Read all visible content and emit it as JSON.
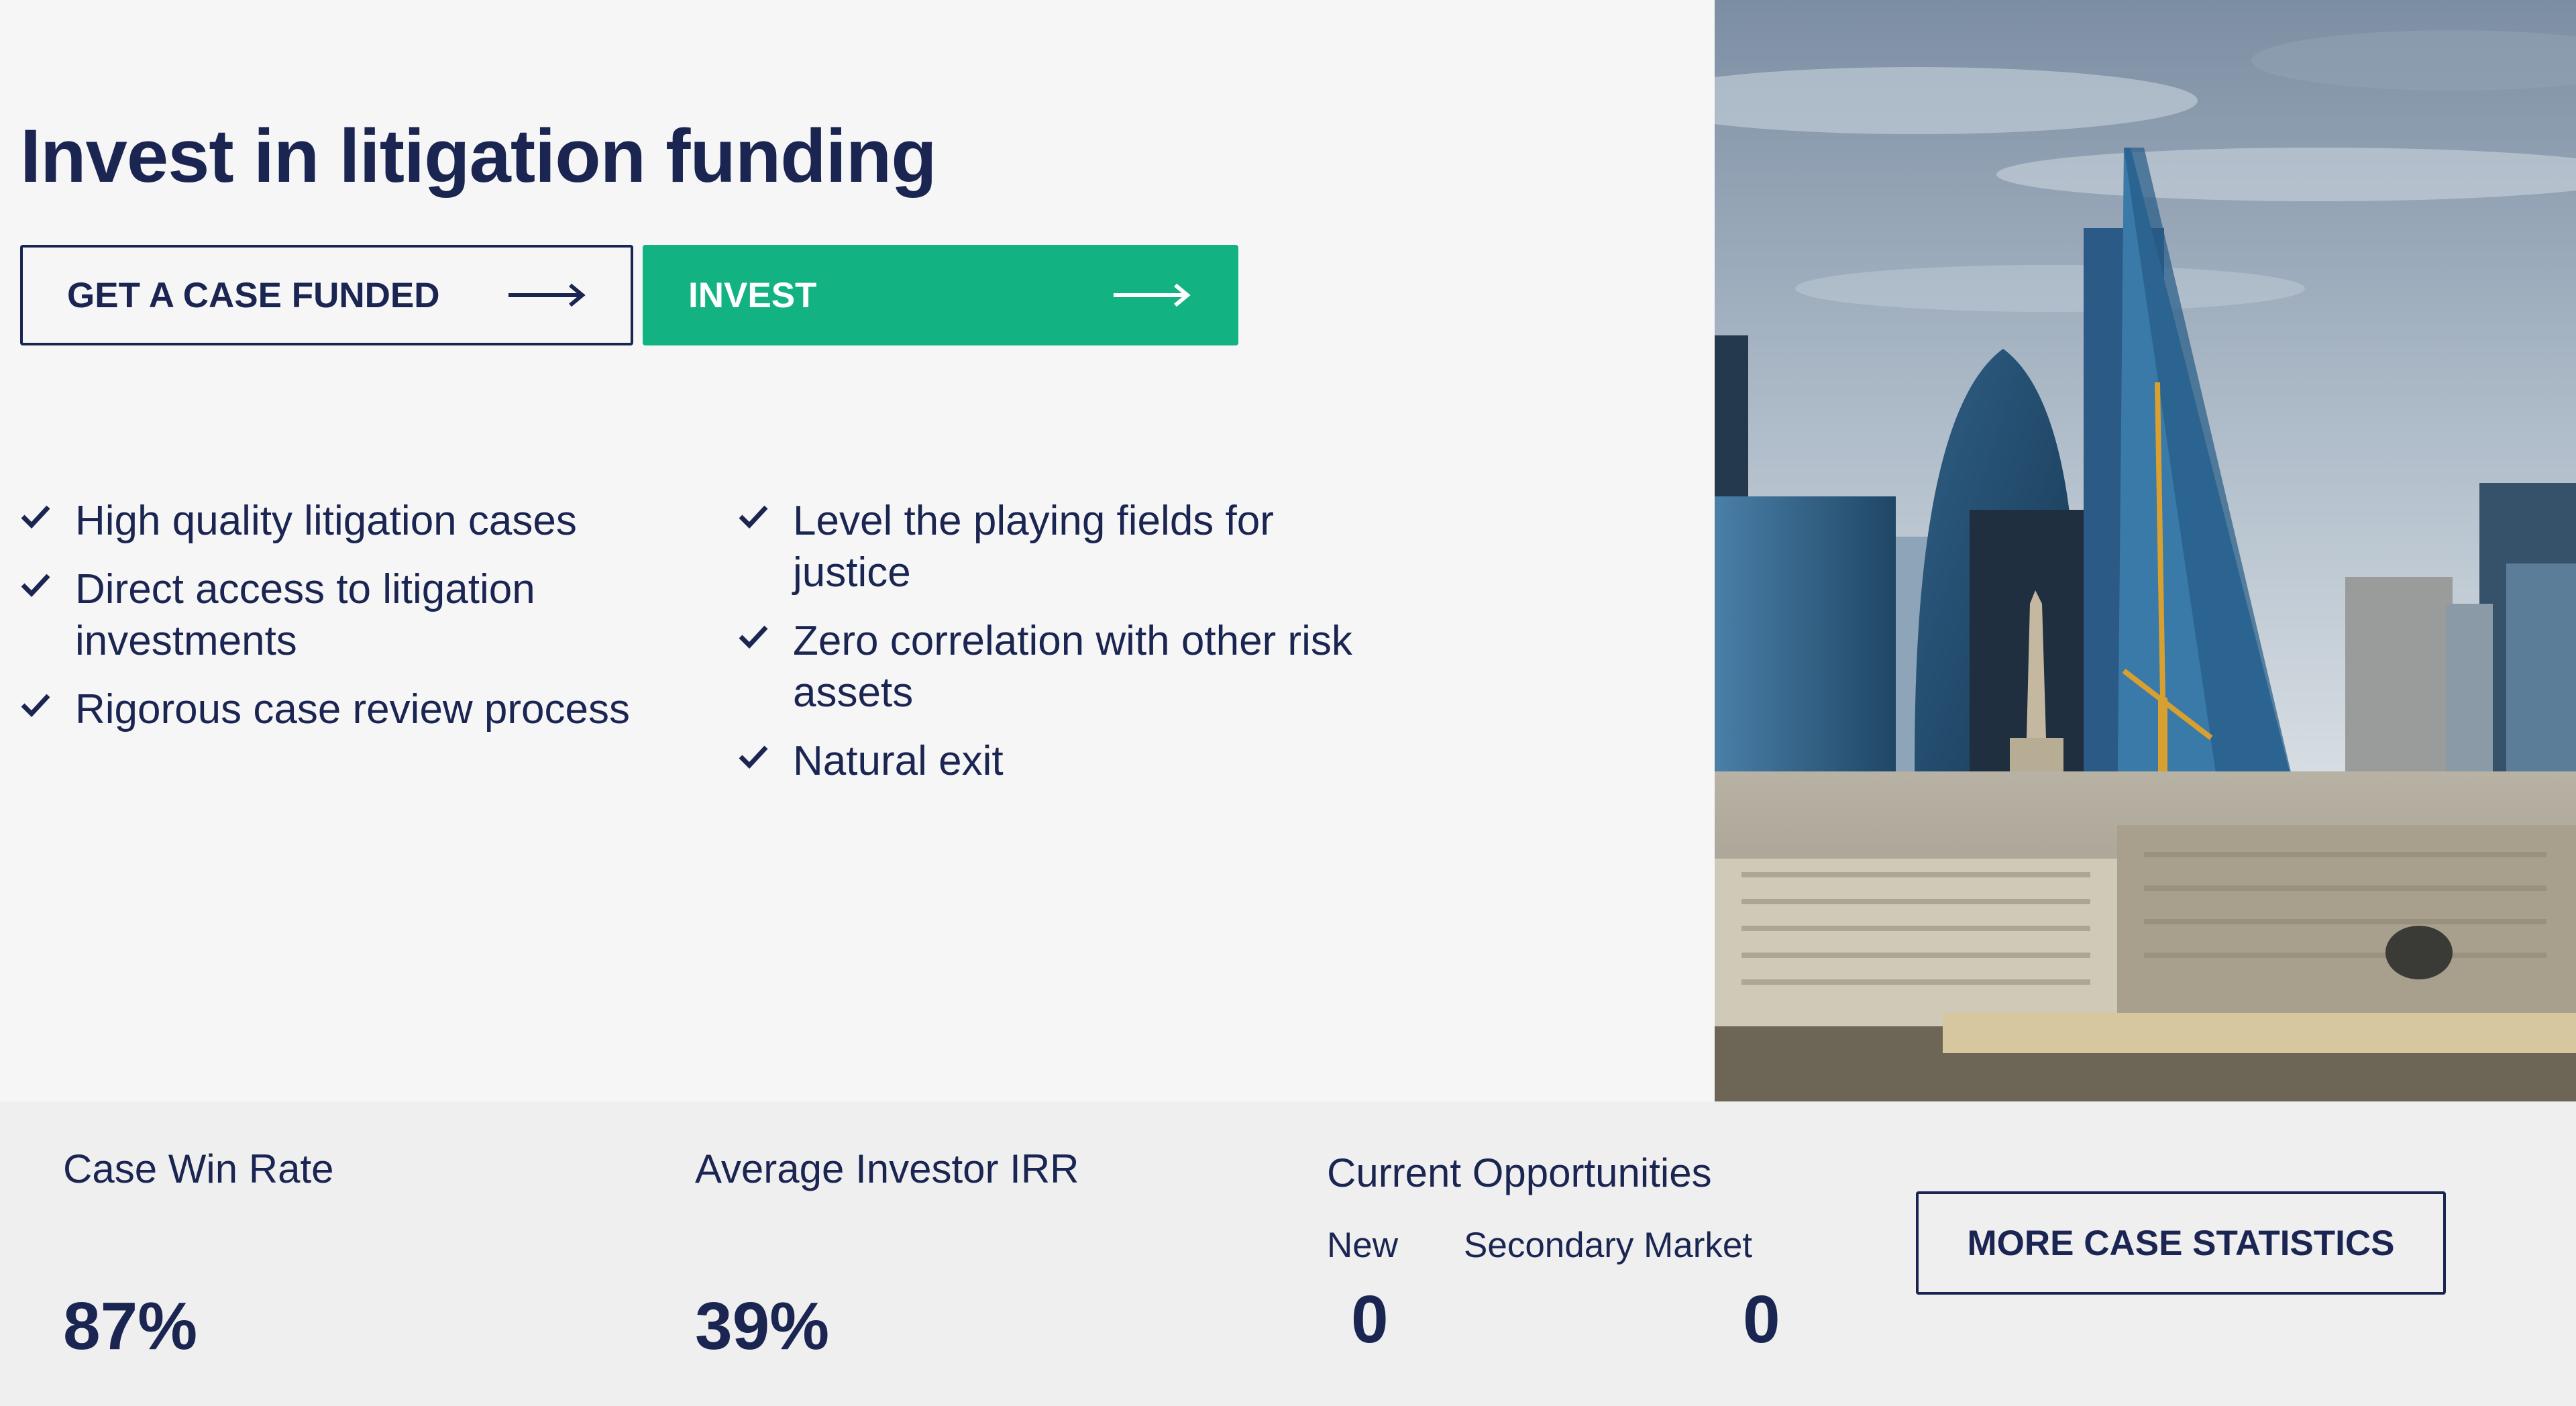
{
  "hero": {
    "title": "Invest in litigation funding",
    "buttons": {
      "get_case_funded": "GET A CASE FUNDED",
      "invest": "INVEST"
    },
    "features_left": [
      "High quality litigation cases",
      "Direct access to litigation investments",
      "Rigorous case review process"
    ],
    "features_right": [
      "Level the playing fields for justice",
      "Zero correlation with other risk assets",
      "Natural exit"
    ]
  },
  "stats": {
    "case_win_rate": {
      "label": "Case Win Rate",
      "value": "87%"
    },
    "average_irr": {
      "label": "Average Investor IRR",
      "value": "39%"
    },
    "current_opportunities": {
      "label": "Current Opportunities",
      "new_label": "New",
      "new_value": "0",
      "secondary_label": "Secondary Market",
      "secondary_value": "0"
    },
    "more_button": "MORE CASE STATISTICS"
  },
  "colors": {
    "navy": "#1b2552",
    "accent_green": "#13b283",
    "background": "#f6f6f6",
    "stats_background": "#efefef"
  },
  "icons": {
    "check": "check-icon",
    "arrow": "arrow-right-icon"
  }
}
